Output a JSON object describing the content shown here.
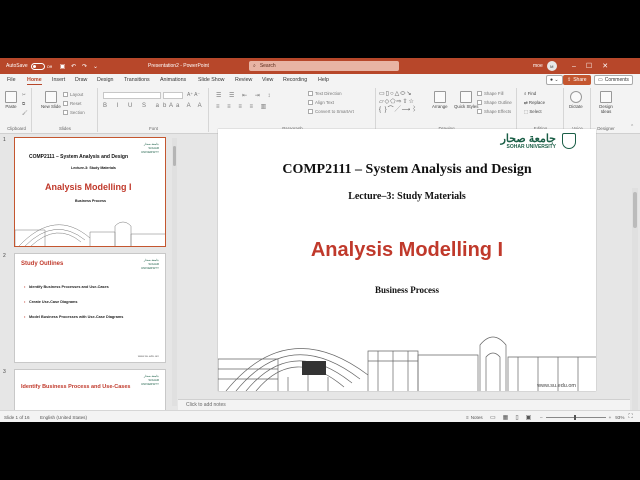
{
  "titlebar": {
    "autosave_label": "AutoSave",
    "autosave_state": "Off",
    "document_title": "Presentation2  -  PowerPoint",
    "search_placeholder": "Search",
    "user_name": "moe",
    "user_initials": "M",
    "accent_color": "#b7472a"
  },
  "tabs": [
    "File",
    "Home",
    "Insert",
    "Draw",
    "Design",
    "Transitions",
    "Animations",
    "Slide Show",
    "Review",
    "View",
    "Recording",
    "Help"
  ],
  "active_tab": "Home",
  "share_label": "Share",
  "comments_label": "Comments",
  "ribbon": {
    "clipboard": {
      "label": "Clipboard",
      "paste": "Paste"
    },
    "slides": {
      "label": "Slides",
      "new_slide": "New Slide",
      "layout": "Layout",
      "reset": "Reset",
      "section": "Section"
    },
    "font": {
      "label": "Font"
    },
    "paragraph": {
      "label": "Paragraph",
      "text_direction": "Text Direction",
      "align_text": "Align Text",
      "convert": "Convert to SmartArt"
    },
    "drawing": {
      "label": "Drawing",
      "arrange": "Arrange",
      "quick_styles": "Quick Styles",
      "shape_fill": "Shape Fill",
      "shape_outline": "Shape Outline",
      "shape_effects": "Shape Effects"
    },
    "editing": {
      "label": "Editing",
      "find": "Find",
      "replace": "Replace",
      "select": "Select"
    },
    "voice": {
      "label": "Voice",
      "dictate": "Dictate"
    },
    "designer": {
      "label": "Designer",
      "design_ideas": "Design Ideas"
    }
  },
  "thumbnails": [
    {
      "number": "1",
      "title": "COMP2111 – System Analysis and Design",
      "subtitle": "Lecture-3: Study Materials",
      "main": "Analysis Modelling I",
      "caption": "Business Process"
    },
    {
      "number": "2",
      "heading": "Study Outlines",
      "bullets": [
        "Identify Business Processes and Use-Cases",
        "Create Use-Case Diagrams",
        "Model Business Processes with Use-Case Diagrams"
      ],
      "url": "www.su.edu.om"
    },
    {
      "number": "3",
      "heading": "Identify Business Process and Use-Cases"
    }
  ],
  "slide": {
    "title": "COMP2111 – System Analysis and Design",
    "subtitle": "Lecture–3: Study Materials",
    "main_heading": "Analysis Modelling I",
    "caption": "Business Process",
    "logo_arabic": "جامعة صحار",
    "logo_english": "SOHAR UNIVERSITY",
    "url": "www.su.edu.om",
    "heading_color": "#c0392b"
  },
  "notes_placeholder": "Click to add notes",
  "status": {
    "slide_count": "Slide 1 of 16",
    "language": "English (United States)",
    "notes": "Notes",
    "zoom": "93%"
  }
}
